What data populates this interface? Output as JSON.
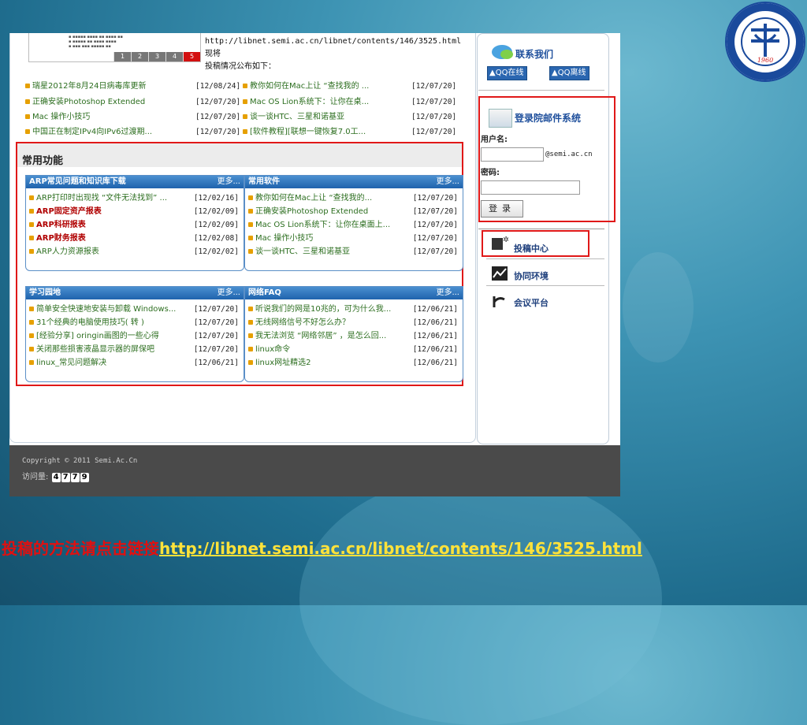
{
  "top": {
    "url_line": "http://libnet.semi.ac.cn/libnet/contents/146/3525.html 现将",
    "desc_line": "投稿情况公布如下：",
    "pager": [
      "1",
      "2",
      "3",
      "4",
      "5"
    ]
  },
  "news": [
    {
      "t1": "瑞星2012年8月24日病毒库更新",
      "d1": "[12/08/24]",
      "t2": "教你如何在Mac上让 “查找我的 ...",
      "d2": "[12/07/20]"
    },
    {
      "t1": "正确安装Photoshop Extended",
      "d1": "[12/07/20]",
      "t2": "Mac OS Lion系统下：让你在桌...",
      "d2": "[12/07/20]"
    },
    {
      "t1": "Mac 操作小技巧",
      "d1": "[12/07/20]",
      "t2": "谈一谈HTC、三星和诺基亚",
      "d2": "[12/07/20]"
    },
    {
      "t1": "中国正在制定IPv4向IPv6过渡期...",
      "d1": "[12/07/20]",
      "t2": "[软件教程][联想一键恢复7.0工...",
      "d2": "[12/07/20]"
    }
  ],
  "common": {
    "title": "常用功能",
    "more": "更多...",
    "panels": [
      {
        "title": "ARP常见问题和知识库下载",
        "rows": [
          {
            "t": "ARP打印时出现找 “文件无法找到” ...",
            "d": "[12/02/16]",
            "style": "grn"
          },
          {
            "t": "ARP固定资产报表",
            "d": "[12/02/09]",
            "style": "red"
          },
          {
            "t": "ARP科研报表",
            "d": "[12/02/09]",
            "style": "red"
          },
          {
            "t": "ARP财务报表",
            "d": "[12/02/08]",
            "style": "red"
          },
          {
            "t": "ARP人力资源报表",
            "d": "[12/02/02]",
            "style": "grn"
          }
        ]
      },
      {
        "title": "常用软件",
        "rows": [
          {
            "t": "教你如何在Mac上让 “查找我的...",
            "d": "[12/07/20]",
            "style": "grn"
          },
          {
            "t": "正确安装Photoshop Extended",
            "d": "[12/07/20]",
            "style": "grn"
          },
          {
            "t": "Mac OS Lion系统下：让你在桌面上...",
            "d": "[12/07/20]",
            "style": "grn"
          },
          {
            "t": "Mac 操作小技巧",
            "d": "[12/07/20]",
            "style": "grn"
          },
          {
            "t": "谈一谈HTC、三星和诺基亚",
            "d": "[12/07/20]",
            "style": "grn"
          }
        ]
      },
      {
        "title": "学习园地",
        "rows": [
          {
            "t": "简单安全快速地安装与卸载 Windows...",
            "d": "[12/07/20]",
            "style": "grn"
          },
          {
            "t": "31个经典的电脑使用技巧( 转 )",
            "d": "[12/07/20]",
            "style": "grn"
          },
          {
            "t": "[经验分享] oringin画图的一些心得",
            "d": "[12/07/20]",
            "style": "grn"
          },
          {
            "t": "关闭那些损害液晶显示器的屏保吧",
            "d": "[12/07/20]",
            "style": "grn"
          },
          {
            "t": "linux_常见问题解决",
            "d": "[12/06/21]",
            "style": "grn"
          }
        ]
      },
      {
        "title": "网络FAQ",
        "rows": [
          {
            "t": "听说我们的网是10兆的，可为什么我...",
            "d": "[12/06/21]",
            "style": "grn"
          },
          {
            "t": "无线网络信号不好怎么办？",
            "d": "[12/06/21]",
            "style": "grn"
          },
          {
            "t": "我无法浏览 “网络邻居” ，是怎么回...",
            "d": "[12/06/21]",
            "style": "grn"
          },
          {
            "t": "linux命令",
            "d": "[12/06/21]",
            "style": "grn"
          },
          {
            "t": "linux网址精选2",
            "d": "[12/06/21]",
            "style": "grn"
          }
        ]
      }
    ]
  },
  "sidebar": {
    "contact_title": "联系我们",
    "qq_online": "QQ在线",
    "qq_offline": "QQ离线",
    "mail_title": "登录院邮件系统",
    "username_label": "用户名:",
    "domain_suffix": "@semi.ac.cn",
    "password_label": "密码:",
    "login_button": "登录",
    "nav": [
      "投稿中心",
      "协同环境",
      "会议平台"
    ]
  },
  "footer": {
    "copyright": "Copyright © 2011 Semi.Ac.Cn",
    "visits_label": "访问量:",
    "visits_digits": [
      "4",
      "7",
      "7",
      "9"
    ]
  },
  "caption": {
    "prefix": "投稿的方法请点击链接",
    "link": "http://libnet.semi.ac.cn/libnet/contents/146/3525.html"
  },
  "logo": {
    "ring_text": "Institute of Semiconductors CAS",
    "year": "1960"
  }
}
